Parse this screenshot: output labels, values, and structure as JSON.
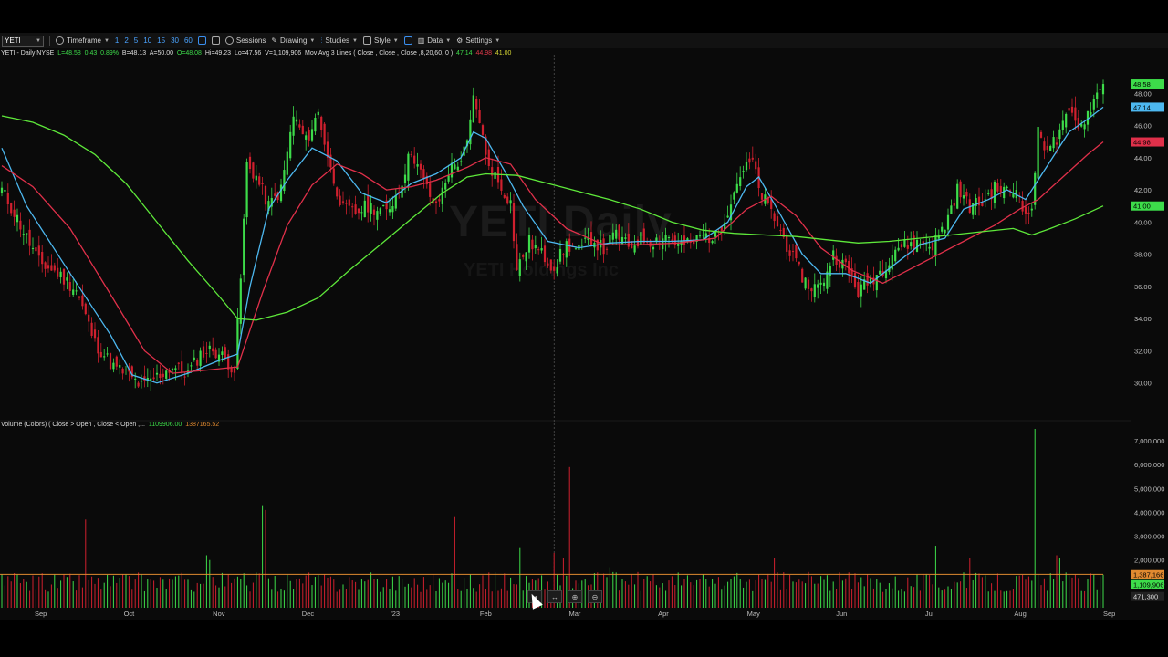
{
  "toolbar": {
    "symbol": "YETI",
    "timeframe_label": "Timeframe",
    "intervals": [
      "1",
      "2",
      "5",
      "10",
      "15",
      "30",
      "60"
    ],
    "sessions_label": "Sessions",
    "drawing_label": "Drawing",
    "studies_label": "Studies",
    "style_label": "Style",
    "data_label": "Data",
    "settings_label": "Settings"
  },
  "info": {
    "symbol_line": "YETI - Daily  NYSE",
    "last": "L=48.58",
    "change": "0.43",
    "change_pct": "0.89%",
    "bid": "B=48.13",
    "ask": "A=50.00",
    "open": "O=48.08",
    "high": "Hi=49.23",
    "low": "Lo=47.56",
    "volume": "V=1,109,906",
    "study": "Mov Avg 3 Lines ( Close , Close , Close ,8,20,60, 0 )",
    "ma_fast": "47.14",
    "ma_mid": "44.98",
    "ma_slow": "41.00"
  },
  "volume_info": {
    "label": "Volume (Colors) ( Close > Open , Close < Open ,...",
    "value": "1109906.00",
    "avg": "1387165.52"
  },
  "watermark": {
    "symbol": "YETI Daily",
    "company": "YETI Holdings Inc"
  },
  "colors": {
    "up": "#3ddc4a",
    "down": "#d0202e",
    "ma_fast": "#4db8f0",
    "ma_mid": "#e0304a",
    "ma_slow": "#5ee83a",
    "vol_avg": "#e08a30"
  },
  "chart_data": {
    "type": "candlestick",
    "title": "",
    "price_axis": {
      "ticks": [
        30,
        32,
        34,
        36,
        38,
        40,
        42,
        44,
        46,
        48
      ],
      "range": [
        28,
        50
      ]
    },
    "volume_axis": {
      "ticks": [
        1000000,
        2000000,
        3000000,
        4000000,
        5000000,
        6000000,
        7000000
      ],
      "tick_labels": [
        "1,000,000",
        "2,000,000",
        "3,000,000",
        "4,000,000",
        "5,000,000",
        "6,000,000",
        "7,000,000"
      ],
      "range": [
        0,
        7500000
      ]
    },
    "x_labels": [
      "Sep",
      "Oct",
      "Nov",
      "Dec",
      "'23",
      "Feb",
      "Mar",
      "Apr",
      "May",
      "Jun",
      "Jul",
      "Aug",
      "Sep"
    ],
    "price_badges": [
      {
        "label": "48.58",
        "value": 48.58,
        "color": "#3ddc4a"
      },
      {
        "label": "47.14",
        "value": 47.14,
        "color": "#4db8f0"
      },
      {
        "label": "44.98",
        "value": 44.98,
        "color": "#e0304a"
      },
      {
        "label": "41.00",
        "value": 41.0,
        "color": "#3ddc4a"
      }
    ],
    "volume_badges": [
      {
        "label": "1,387,166",
        "value": 1387166,
        "color": "#e08a30"
      },
      {
        "label": "1,109,906",
        "value": 1109906,
        "color": "#3ddc4a"
      },
      {
        "label": "471,300",
        "value": 471300,
        "color": "#222"
      }
    ],
    "close_anchors": [
      [
        0,
        42.0
      ],
      [
        5,
        40.2
      ],
      [
        12,
        37.5
      ],
      [
        18,
        36.8
      ],
      [
        24,
        35.8
      ],
      [
        30,
        32.5
      ],
      [
        36,
        31.0
      ],
      [
        40,
        30.6
      ],
      [
        45,
        29.8
      ],
      [
        50,
        30.4
      ],
      [
        55,
        31.0
      ],
      [
        60,
        30.6
      ],
      [
        64,
        31.8
      ],
      [
        68,
        32.1
      ],
      [
        72,
        31.5
      ],
      [
        75,
        30.8
      ],
      [
        77,
        36.5
      ],
      [
        79,
        43.6
      ],
      [
        82,
        42.8
      ],
      [
        86,
        41.0
      ],
      [
        90,
        42.0
      ],
      [
        94,
        46.6
      ],
      [
        98,
        45.0
      ],
      [
        102,
        46.8
      ],
      [
        106,
        43.2
      ],
      [
        110,
        40.8
      ],
      [
        114,
        40.6
      ],
      [
        118,
        41.0
      ],
      [
        124,
        40.6
      ],
      [
        128,
        42.0
      ],
      [
        132,
        44.5
      ],
      [
        136,
        42.5
      ],
      [
        140,
        40.8
      ],
      [
        144,
        43.2
      ],
      [
        148,
        43.9
      ],
      [
        150,
        44.8
      ],
      [
        152,
        47.6
      ],
      [
        154,
        46.4
      ],
      [
        156,
        44.0
      ],
      [
        160,
        42.5
      ],
      [
        164,
        41.2
      ],
      [
        166,
        37.0
      ],
      [
        170,
        38.8
      ],
      [
        174,
        38.0
      ],
      [
        178,
        37.2
      ],
      [
        182,
        38.6
      ],
      [
        186,
        38.2
      ],
      [
        190,
        39.0
      ],
      [
        194,
        38.3
      ],
      [
        198,
        39.3
      ],
      [
        202,
        38.4
      ],
      [
        206,
        39.0
      ],
      [
        210,
        38.8
      ],
      [
        214,
        39.2
      ],
      [
        218,
        38.6
      ],
      [
        222,
        38.6
      ],
      [
        226,
        39.2
      ],
      [
        230,
        39.0
      ],
      [
        234,
        40.8
      ],
      [
        238,
        43.0
      ],
      [
        242,
        43.8
      ],
      [
        244,
        42.0
      ],
      [
        248,
        40.6
      ],
      [
        252,
        39.0
      ],
      [
        256,
        37.3
      ],
      [
        260,
        36.0
      ],
      [
        264,
        36.0
      ],
      [
        268,
        38.0
      ],
      [
        272,
        37.2
      ],
      [
        276,
        35.7
      ],
      [
        280,
        36.4
      ],
      [
        284,
        37.1
      ],
      [
        288,
        38.4
      ],
      [
        292,
        38.6
      ],
      [
        296,
        38.7
      ],
      [
        300,
        38.6
      ],
      [
        304,
        39.8
      ],
      [
        308,
        42.0
      ],
      [
        312,
        41.0
      ],
      [
        316,
        41.2
      ],
      [
        320,
        42.1
      ],
      [
        324,
        41.9
      ],
      [
        328,
        42.0
      ],
      [
        330,
        40.2
      ],
      [
        332,
        41.0
      ],
      [
        334,
        45.5
      ],
      [
        336,
        44.8
      ],
      [
        340,
        45.0
      ],
      [
        344,
        46.8
      ],
      [
        348,
        46.0
      ],
      [
        352,
        47.6
      ],
      [
        355,
        48.58
      ]
    ],
    "moving_averages": {
      "ma8": [
        [
          0,
          44.6
        ],
        [
          8,
          41.0
        ],
        [
          20,
          37.4
        ],
        [
          35,
          33.0
        ],
        [
          42,
          30.5
        ],
        [
          50,
          30.0
        ],
        [
          60,
          30.6
        ],
        [
          70,
          31.4
        ],
        [
          76,
          31.8
        ],
        [
          80,
          36.0
        ],
        [
          86,
          40.8
        ],
        [
          92,
          42.6
        ],
        [
          100,
          44.6
        ],
        [
          108,
          43.8
        ],
        [
          116,
          41.8
        ],
        [
          124,
          41.2
        ],
        [
          132,
          42.4
        ],
        [
          140,
          43.0
        ],
        [
          148,
          44.0
        ],
        [
          152,
          45.6
        ],
        [
          156,
          45.2
        ],
        [
          162,
          43.2
        ],
        [
          168,
          41.0
        ],
        [
          176,
          38.8
        ],
        [
          186,
          38.4
        ],
        [
          196,
          38.7
        ],
        [
          206,
          38.8
        ],
        [
          216,
          38.8
        ],
        [
          226,
          38.9
        ],
        [
          234,
          40.0
        ],
        [
          240,
          42.2
        ],
        [
          244,
          42.8
        ],
        [
          250,
          40.8
        ],
        [
          258,
          38.0
        ],
        [
          264,
          36.8
        ],
        [
          272,
          36.8
        ],
        [
          280,
          36.2
        ],
        [
          288,
          37.4
        ],
        [
          296,
          38.6
        ],
        [
          304,
          39.0
        ],
        [
          310,
          40.8
        ],
        [
          318,
          41.4
        ],
        [
          324,
          42.0
        ],
        [
          330,
          41.4
        ],
        [
          336,
          43.2
        ],
        [
          344,
          45.6
        ],
        [
          350,
          46.4
        ],
        [
          355,
          47.14
        ]
      ],
      "ma20": [
        [
          0,
          43.5
        ],
        [
          10,
          42.2
        ],
        [
          22,
          39.6
        ],
        [
          36,
          35.2
        ],
        [
          46,
          32.0
        ],
        [
          55,
          30.6
        ],
        [
          66,
          30.8
        ],
        [
          76,
          31.0
        ],
        [
          84,
          35.6
        ],
        [
          92,
          39.8
        ],
        [
          100,
          42.3
        ],
        [
          108,
          43.6
        ],
        [
          116,
          43.0
        ],
        [
          124,
          42.0
        ],
        [
          132,
          42.2
        ],
        [
          140,
          42.6
        ],
        [
          150,
          43.4
        ],
        [
          156,
          44.0
        ],
        [
          164,
          43.6
        ],
        [
          172,
          41.4
        ],
        [
          182,
          39.6
        ],
        [
          194,
          38.6
        ],
        [
          206,
          38.6
        ],
        [
          218,
          38.7
        ],
        [
          230,
          39.0
        ],
        [
          240,
          40.8
        ],
        [
          248,
          41.6
        ],
        [
          256,
          40.4
        ],
        [
          264,
          38.4
        ],
        [
          274,
          37.0
        ],
        [
          284,
          36.2
        ],
        [
          292,
          37.0
        ],
        [
          300,
          37.8
        ],
        [
          310,
          38.8
        ],
        [
          320,
          39.8
        ],
        [
          328,
          40.8
        ],
        [
          334,
          41.4
        ],
        [
          342,
          42.8
        ],
        [
          350,
          44.2
        ],
        [
          355,
          44.98
        ]
      ],
      "ma60": [
        [
          0,
          46.6
        ],
        [
          10,
          46.2
        ],
        [
          20,
          45.4
        ],
        [
          30,
          44.2
        ],
        [
          40,
          42.4
        ],
        [
          50,
          40.0
        ],
        [
          60,
          37.6
        ],
        [
          70,
          35.4
        ],
        [
          76,
          34.0
        ],
        [
          82,
          33.9
        ],
        [
          92,
          34.4
        ],
        [
          102,
          35.3
        ],
        [
          112,
          37.0
        ],
        [
          122,
          38.6
        ],
        [
          132,
          40.2
        ],
        [
          142,
          41.8
        ],
        [
          150,
          42.8
        ],
        [
          156,
          43.0
        ],
        [
          166,
          42.9
        ],
        [
          176,
          42.4
        ],
        [
          186,
          41.9
        ],
        [
          196,
          41.4
        ],
        [
          206,
          40.8
        ],
        [
          216,
          40.0
        ],
        [
          226,
          39.5
        ],
        [
          236,
          39.3
        ],
        [
          246,
          39.2
        ],
        [
          256,
          39.1
        ],
        [
          266,
          38.9
        ],
        [
          276,
          38.7
        ],
        [
          286,
          38.8
        ],
        [
          296,
          39.0
        ],
        [
          306,
          39.2
        ],
        [
          316,
          39.4
        ],
        [
          326,
          39.6
        ],
        [
          332,
          39.2
        ],
        [
          338,
          39.6
        ],
        [
          346,
          40.2
        ],
        [
          355,
          41.0
        ]
      ]
    },
    "volume_spikes": [
      [
        27,
        3700000
      ],
      [
        66,
        2200000
      ],
      [
        67,
        2000000
      ],
      [
        84,
        4300000
      ],
      [
        85,
        4100000
      ],
      [
        146,
        3800000
      ],
      [
        167,
        2500000
      ],
      [
        178,
        2300000
      ],
      [
        181,
        2100000
      ],
      [
        183,
        5900000
      ],
      [
        196,
        1700000
      ],
      [
        203,
        1400000
      ],
      [
        249,
        2100000
      ],
      [
        260,
        1500000
      ],
      [
        301,
        2600000
      ],
      [
        312,
        2100000
      ],
      [
        333,
        7500000
      ],
      [
        340,
        2200000
      ],
      [
        341,
        2100000
      ]
    ],
    "volume_base": 1200000,
    "volume_avg_level": 1400000,
    "crosshair_bar": 178
  }
}
